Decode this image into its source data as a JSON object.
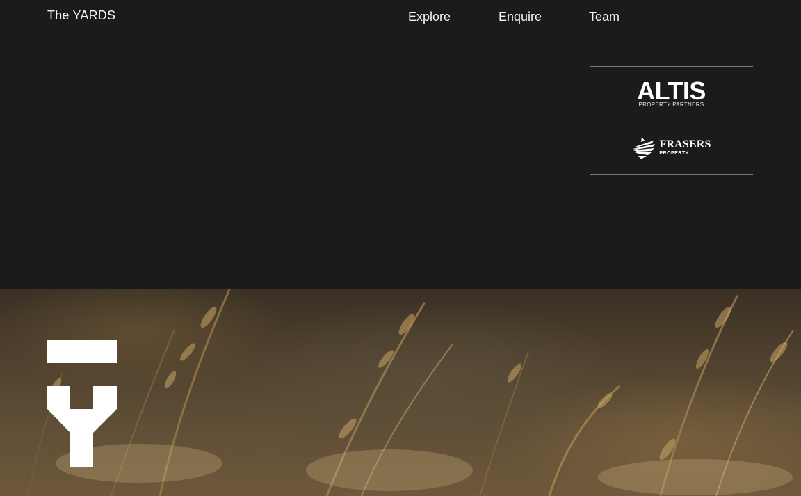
{
  "header": {
    "brand": "The YARDS",
    "nav": [
      {
        "label": "Explore"
      },
      {
        "label": "Enquire"
      },
      {
        "label": "Team"
      }
    ]
  },
  "partners": {
    "altis": {
      "name": "ALTIS",
      "tagline": "PROPERTY PARTNERS"
    },
    "frasers": {
      "name": "FRASERS",
      "tagline": "PROPERTY",
      "icon": "frasers-wing-icon"
    }
  },
  "hero": {
    "image": "wheat-grass-field",
    "logo_icon": "yards-y-mark-icon"
  },
  "colors": {
    "background": "#1b1b1b",
    "text": "#ffffff",
    "divider": "#7a7a7a"
  }
}
